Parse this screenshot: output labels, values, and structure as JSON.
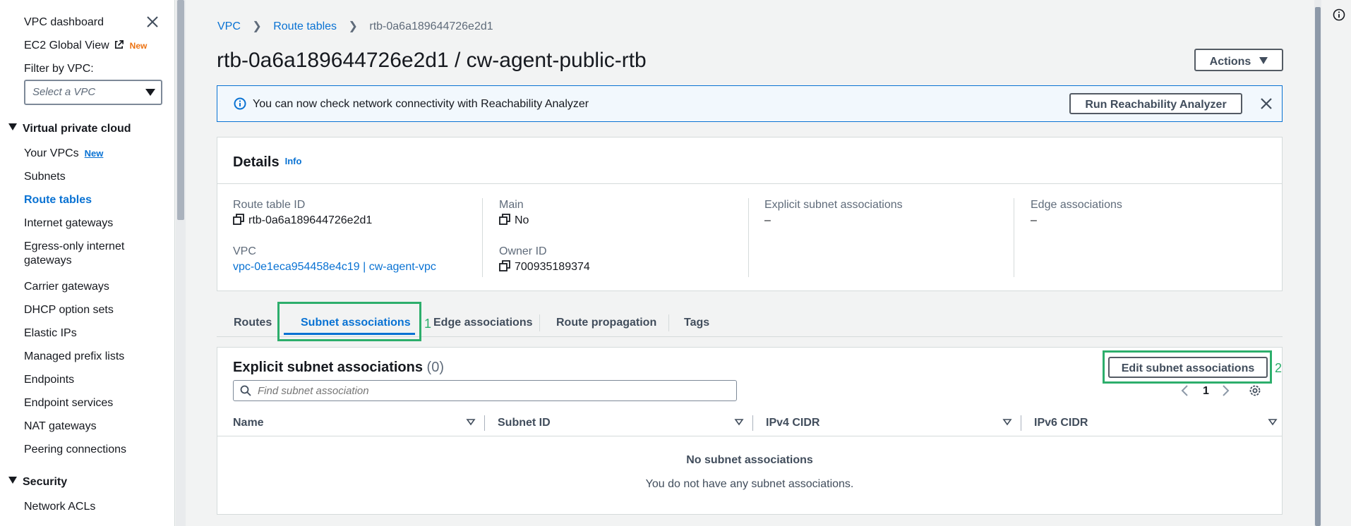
{
  "sidebar": {
    "top_links": [
      {
        "label": "VPC dashboard"
      },
      {
        "label": "EC2 Global View",
        "badge": "New"
      }
    ],
    "filter_label": "Filter by VPC:",
    "vpc_select_placeholder": "Select a VPC",
    "sections": [
      {
        "title": "Virtual private cloud",
        "items": [
          {
            "label": "Your VPCs",
            "badge": "New"
          },
          {
            "label": "Subnets"
          },
          {
            "label": "Route tables",
            "active": true
          },
          {
            "label": "Internet gateways"
          },
          {
            "label": "Egress-only internet",
            "label_line2": "gateways"
          },
          {
            "label": "Carrier gateways"
          },
          {
            "label": "DHCP option sets"
          },
          {
            "label": "Elastic IPs"
          },
          {
            "label": "Managed prefix lists"
          },
          {
            "label": "Endpoints"
          },
          {
            "label": "Endpoint services"
          },
          {
            "label": "NAT gateways"
          },
          {
            "label": "Peering connections"
          }
        ]
      },
      {
        "title": "Security",
        "items": [
          {
            "label": "Network ACLs"
          }
        ]
      }
    ]
  },
  "breadcrumb": {
    "items": [
      "VPC",
      "Route tables"
    ],
    "current": "rtb-0a6a189644726e2d1"
  },
  "page_title": "rtb-0a6a189644726e2d1 / cw-agent-public-rtb",
  "actions_label": "Actions",
  "banner": {
    "message": "You can now check network connectivity with Reachability Analyzer",
    "button_label": "Run Reachability Analyzer"
  },
  "details": {
    "title": "Details",
    "info_label": "Info",
    "fields": {
      "route_table_id_label": "Route table ID",
      "route_table_id": "rtb-0a6a189644726e2d1",
      "main_label": "Main",
      "main": "No",
      "explicit_label": "Explicit subnet associations",
      "explicit": "–",
      "edge_label": "Edge associations",
      "edge": "–",
      "vpc_label": "VPC",
      "vpc": "vpc-0e1eca954458e4c19 | cw-agent-vpc",
      "owner_label": "Owner ID",
      "owner": "700935189374"
    }
  },
  "tabs": [
    "Routes",
    "Subnet associations",
    "Edge associations",
    "Route propagation",
    "Tags"
  ],
  "active_tab": "Subnet associations",
  "annotations": [
    "1",
    "2"
  ],
  "subnet_assoc": {
    "title": "Explicit subnet associations",
    "count": "(0)",
    "edit_button_label": "Edit subnet associations",
    "search_placeholder": "Find subnet association",
    "page_number": "1",
    "columns": [
      "Name",
      "Subnet ID",
      "IPv4 CIDR",
      "IPv6 CIDR"
    ],
    "empty_title": "No subnet associations",
    "empty_message": "You do not have any subnet associations."
  },
  "colors": {
    "link": "#0972d3",
    "annotation": "#2dae6c",
    "new_badge_orange": "#ec7211",
    "banner_bg": "#f2f8fd"
  }
}
